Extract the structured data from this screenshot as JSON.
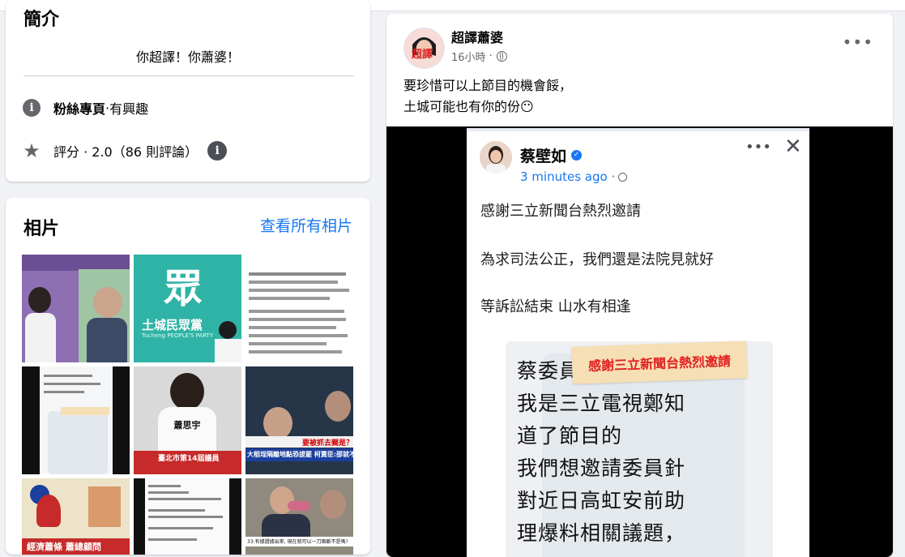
{
  "intro": {
    "title": "簡介",
    "bio": "你超譯！你蕭婆！",
    "category_label": "粉絲專頁",
    "category_sep": " · ",
    "category_value": "有興趣",
    "rating_text": "評分 · 2.0（86 則評論）"
  },
  "photos": {
    "title": "相片",
    "see_all": "查看所有相片",
    "thumbs": {
      "t2_logo": "眾",
      "t2_caption": "土城民眾黨",
      "t2_sub": "Tucheng PEOPLE'S PARTY",
      "t5_shirt": "蕭思宇",
      "t5_banner": "臺北市第14屆議員",
      "t6_banner": "要被抓去關是？",
      "t6_ticker": "大稻埕隔離地點恐拔罷 柯賣臣:邵就不",
      "t7_banner": "經濟蕭條 蕭總顧問",
      "t9_banner": "33:有據證據出來, 現在就可以一刀兩斷不是嗎?"
    }
  },
  "post": {
    "page_name": "超譯蕭婆",
    "time": "16小時",
    "text_line1": "要珍惜可以上節目的機會餒，",
    "text_line2": "土城可能也有你的份😶",
    "embedded": {
      "name": "蔡壁如",
      "time": "3 minutes ago",
      "line1": "感謝三立新聞台熱烈邀請",
      "line2": "為求司法公正，我們還是法院見就好",
      "line3": "等訴訟結束 山水有相逢",
      "tape_text": "感謝三立新聞台熱烈邀請",
      "bubble_lines": [
        "蔡委員",
        "我是三立電視鄭知",
        "道了節目的",
        "我們想邀請委員針",
        "對近日高虹安前助",
        "理爆料相關議題，"
      ]
    }
  },
  "colors": {
    "link": "#1877f2",
    "secondary_text": "#65676b",
    "background": "#f0f2f5"
  }
}
